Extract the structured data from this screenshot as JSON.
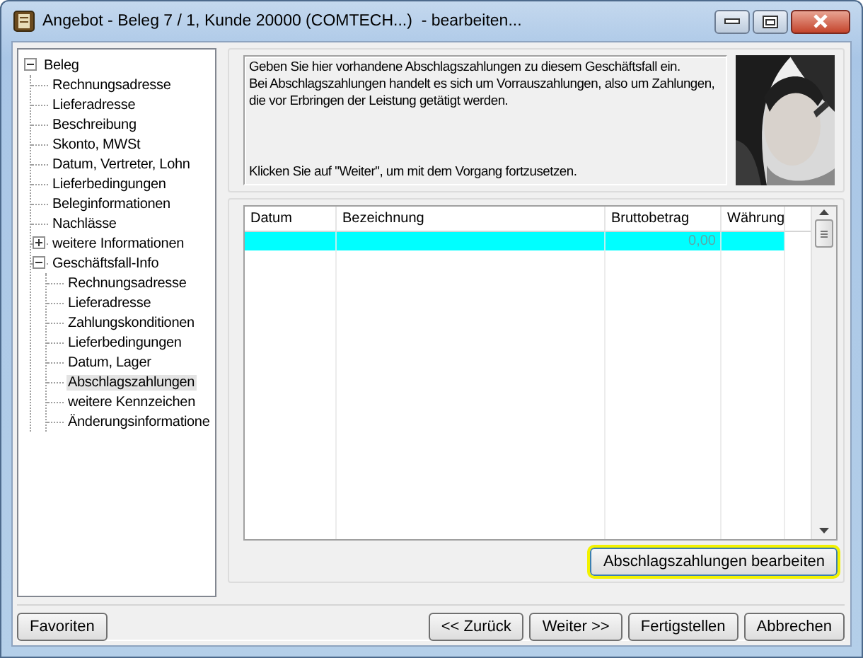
{
  "window": {
    "title": "Angebot - Beleg 7 / 1, Kunde 20000 (COMTECH...)  - bearbeiten..."
  },
  "tree": [
    {
      "label": "Beleg",
      "expanded": true,
      "selected": false,
      "children": [
        {
          "label": "Rechnungsadresse",
          "selected": false
        },
        {
          "label": "Lieferadresse",
          "selected": false
        },
        {
          "label": "Beschreibung",
          "selected": false
        },
        {
          "label": "Skonto, MWSt",
          "selected": false
        },
        {
          "label": "Datum, Vertreter, Lohn",
          "selected": false
        },
        {
          "label": "Lieferbedingungen",
          "selected": false
        },
        {
          "label": "Beleginformationen",
          "selected": false
        },
        {
          "label": "Nachlässe",
          "selected": false
        },
        {
          "label": "weitere Informationen",
          "expanded": false,
          "selected": false
        },
        {
          "label": "Geschäftsfall-Info",
          "expanded": true,
          "selected": false,
          "children": [
            {
              "label": "Rechnungsadresse",
              "selected": false
            },
            {
              "label": "Lieferadresse",
              "selected": false
            },
            {
              "label": "Zahlungskonditionen",
              "selected": false
            },
            {
              "label": "Lieferbedingungen",
              "selected": false
            },
            {
              "label": "Datum, Lager",
              "selected": false
            },
            {
              "label": "Abschlagszahlungen",
              "selected": true
            },
            {
              "label": "weitere Kennzeichen",
              "selected": false
            },
            {
              "label": "Änderungsinformatione",
              "selected": false
            }
          ]
        }
      ]
    }
  ],
  "info": {
    "text": "Geben Sie hier vorhandene Abschlagszahlungen zu diesem Geschäftsfall ein.\nBei Abschlagszahlungen handelt es sich um Vorrauszahlungen, also um Zahlungen,\ndie vor Erbringen der Leistung getätigt werden.",
    "hint": "Klicken Sie auf \"Weiter\", um mit dem Vorgang fortzusetzen."
  },
  "payments": {
    "columns": [
      "Datum",
      "Bezeichnung",
      "Bruttobetrag",
      "Währung"
    ],
    "rows": [
      {
        "selected": true,
        "column_3": "0,00"
      }
    ]
  },
  "edit_button": {
    "label": "Abschlagszahlungen bearbeiten",
    "highlighted": true
  },
  "footer": {
    "left_buttons": [
      "Favoriten"
    ],
    "right_buttons": [
      "<< Zurück",
      "Weiter >>",
      "Fertigstellen",
      "Abbrechen"
    ]
  }
}
